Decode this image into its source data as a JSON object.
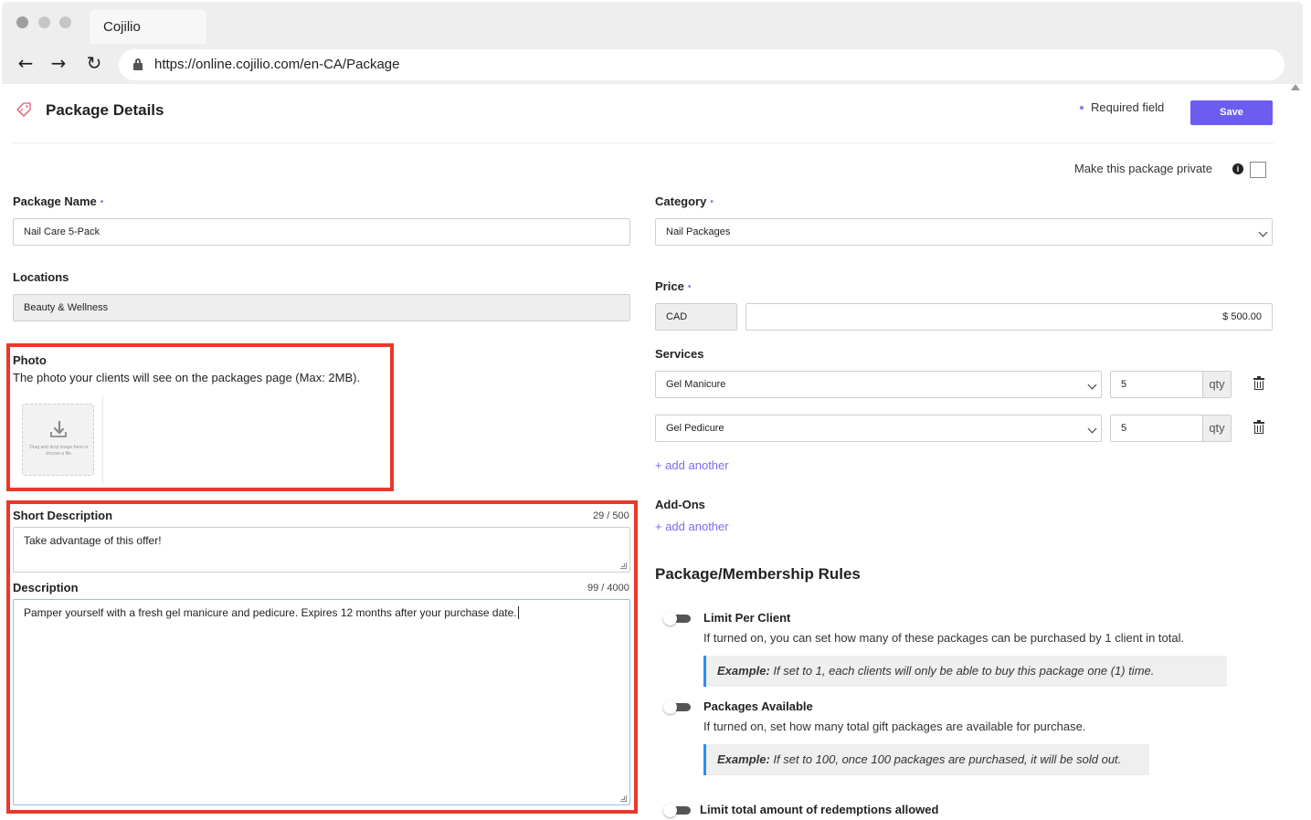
{
  "browser": {
    "tab_title": "Cojilio",
    "url": "https://online.cojilio.com/en-CA/Package"
  },
  "header": {
    "title": "Package Details",
    "required_label": "Required field",
    "save_label": "Save"
  },
  "private": {
    "label": "Make this package private",
    "info_glyph": "i",
    "checked": false
  },
  "form": {
    "package_name_label": "Package Name",
    "package_name_value": "Nail Care 5-Pack",
    "locations_label": "Locations",
    "locations_value": "Beauty & Wellness",
    "photo_label": "Photo",
    "photo_desc": "The photo your clients will see on the packages page (Max: 2MB).",
    "dropzone_text": "Drag and drop image here or choose a file.",
    "short_desc_label": "Short Description",
    "short_desc_counter": "29 / 500",
    "short_desc_value": "Take advantage of this offer!",
    "desc_label": "Description",
    "desc_counter": "99 / 4000",
    "desc_value": "Pamper yourself with a fresh gel manicure and pedicure. Expires 12 months after your purchase date."
  },
  "right": {
    "category_label": "Category",
    "category_value": "Nail Packages",
    "price_label": "Price",
    "currency": "CAD",
    "price_value": "$ 500.00",
    "services_label": "Services",
    "services": [
      {
        "name": "Gel Manicure",
        "qty": "5",
        "suffix": "qty"
      },
      {
        "name": "Gel Pedicure",
        "qty": "5",
        "suffix": "qty"
      }
    ],
    "add_another": "+ add another",
    "addons_label": "Add-Ons",
    "addons_add": "+ add another"
  },
  "rules": {
    "title": "Package/Membership Rules",
    "items": [
      {
        "title": "Limit Per Client",
        "desc": "If turned on, you can set how many of these packages can be purchased by 1 client in total.",
        "example_label": "Example:",
        "example_text": " If set to 1, each clients will only be able to buy this package one (1) time."
      },
      {
        "title": "Packages Available",
        "desc": "If turned on, set how many total gift packages are available for purchase.",
        "example_label": "Example:",
        "example_text": " If set to 100, once 100 packages are purchased, it will be sold out."
      },
      {
        "title": "Limit total amount of redemptions allowed"
      }
    ]
  },
  "colors": {
    "accent": "#6d5cf0",
    "highlight_box": "#e8392a",
    "example_border": "#2b8ef0"
  }
}
